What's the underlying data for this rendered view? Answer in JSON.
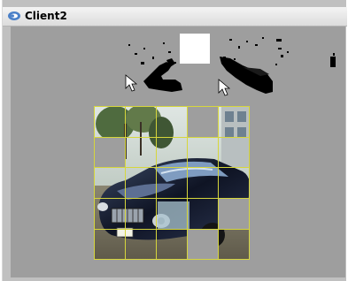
{
  "window": {
    "title": "Client2",
    "icon": "app-icon"
  },
  "capture_strip": {
    "cursor_icons": [
      "mouse-pointer-icon",
      "mouse-pointer-icon"
    ]
  },
  "tile_grid": {
    "columns": 5,
    "rows": 5,
    "grid_color": "#d6d63c",
    "missing_tiles": [
      [
        1,
        0
      ],
      [
        3,
        0
      ],
      [
        4,
        3
      ],
      [
        3,
        4
      ]
    ]
  },
  "colors": {
    "client_background": "#9e9e9e",
    "frame": "#c0c0c0"
  }
}
